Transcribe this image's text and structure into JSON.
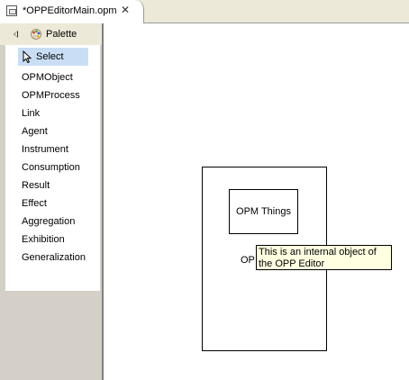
{
  "editor_tab": {
    "title": "*OPPEditorMain.opm",
    "close_glyph": "✕",
    "icon": "opm-file-icon"
  },
  "palette": {
    "title": "Palette",
    "collapse_icon": "collapse-left-icon",
    "icon": "palette-icon",
    "selected_item": "Select",
    "items": [
      "Select",
      "OPMObject",
      "OPMProcess",
      "Link",
      "Agent",
      "Instrument",
      "Consumption",
      "Result",
      "Effect",
      "Aggregation",
      "Exhibition",
      "Generalization"
    ]
  },
  "canvas": {
    "container_label_partial": "OP",
    "thing_label": "OPM Things",
    "tooltip": "This is an internal object of the OPP Editor"
  }
}
